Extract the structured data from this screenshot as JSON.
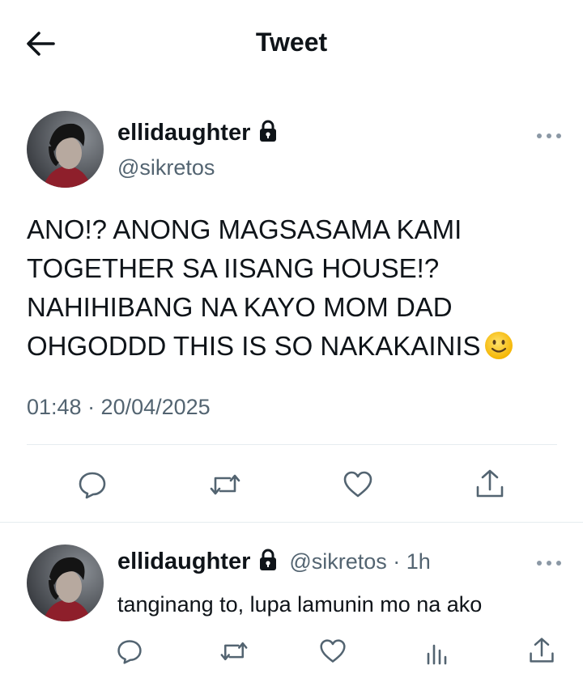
{
  "header": {
    "title": "Tweet",
    "back_icon": "arrow-left-icon"
  },
  "tweet": {
    "display_name": "ellidaughter",
    "handle": "@sikretos",
    "protected_icon": "lock-icon",
    "text": "ANO!? ANONG MAGSASAMA KAMI\nTOGETHER SA IISANG HOUSE!?\nNAHIHIBANG NA KAYO MOM DAD\nOHGODDD THIS IS SO NAKAKAINIS",
    "emoji": "slightly-smiling-face-icon",
    "timestamp": "01:48 · 20/04/2025",
    "actions": [
      "reply-icon",
      "retweet-icon",
      "like-icon",
      "share-icon"
    ]
  },
  "reply": {
    "display_name": "ellidaughter",
    "handle_time": "@sikretos · 1h",
    "text": "tanginang to, lupa lamunin mo na ako",
    "actions": [
      "reply-icon",
      "retweet-icon",
      "like-icon",
      "analytics-icon",
      "share-icon"
    ]
  },
  "colors": {
    "text": "#0f1419",
    "secondary": "#536471",
    "divider": "#e6ecf0"
  }
}
